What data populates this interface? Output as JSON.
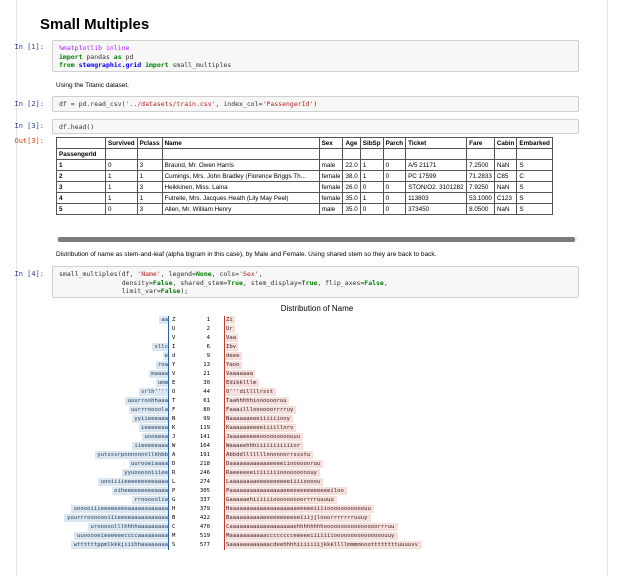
{
  "heading": "Small Multiples",
  "cells": {
    "c1": {
      "prompt": "In [1]:",
      "l1": "%matplotlib inline",
      "l2a": "import",
      "l2b": " pandas ",
      "l2c": "as",
      "l2d": " pd",
      "l3a": "from",
      "l3b": " stemgraphic.grid ",
      "l3c": "import",
      "l3d": " small_multiples"
    },
    "md1": "Using the Titanic dataset.",
    "c2": {
      "prompt": "In [2]:",
      "code_a": "df = pd.read_csv(",
      "code_b": "'../datasets/train.csv'",
      "code_c": ", index_col=",
      "code_d": "'PassengerId'",
      "code_e": ")"
    },
    "c3": {
      "prompt": "In [3]:",
      "code": "df.head()",
      "out_prompt": "Out[3]:"
    },
    "md2": "Distribution of name as stem-and-leaf (alpha bigram in this case), by Male and Female. Using shared stem so they are back to back.",
    "c4": {
      "prompt": "In [4]:",
      "l1a": "small_multiples(df, ",
      "l1b": "'Name'",
      "l1c": ", legend=",
      "l1d": "None",
      "l1e": ", cols=",
      "l1f": "'Sex'",
      "l1g": ",",
      "l2a": "                density=",
      "l2b": "False",
      "l2c": ", shared_stem=",
      "l2d": "True",
      "l2e": ", stem_display=",
      "l2f": "True",
      "l2g": ", flip_axes=",
      "l2h": "False",
      "l2i": ",",
      "l3a": "                limit_var=",
      "l3b": "False",
      "l3c": ");"
    }
  },
  "table": {
    "columns": [
      "",
      "Survived",
      "Pclass",
      "Name",
      "Sex",
      "Age",
      "SibSp",
      "Parch",
      "Ticket",
      "Fare",
      "Cabin",
      "Embarked"
    ],
    "index_name": "PassengerId",
    "rows": [
      [
        "1",
        "0",
        "3",
        "Braund, Mr. Owen Harris",
        "male",
        "22.0",
        "1",
        "0",
        "A/5 21171",
        "7.2500",
        "NaN",
        "S"
      ],
      [
        "2",
        "1",
        "1",
        "Cumings, Mrs. John Bradley (Florence Briggs Th...",
        "female",
        "38.0",
        "1",
        "0",
        "PC 17599",
        "71.2833",
        "C85",
        "C"
      ],
      [
        "3",
        "1",
        "3",
        "Heikkinen, Miss. Laina",
        "female",
        "26.0",
        "0",
        "0",
        "STON/O2. 3101282",
        "7.9250",
        "NaN",
        "S"
      ],
      [
        "4",
        "1",
        "1",
        "Futrelle, Mrs. Jacques Heath (Lily May Peel)",
        "female",
        "35.0",
        "1",
        "0",
        "113803",
        "53.1000",
        "C123",
        "S"
      ],
      [
        "5",
        "0",
        "3",
        "Allen, Mr. William Henry",
        "male",
        "35.0",
        "0",
        "0",
        "373450",
        "8.0500",
        "NaN",
        "S"
      ]
    ]
  },
  "chart_data": {
    "type": "table",
    "title": "Distribution of Name",
    "rows": [
      {
        "left": "aa",
        "stem": "Z",
        "cum": "1",
        "right": "Zi"
      },
      {
        "left": "",
        "stem": "U",
        "cum": "2",
        "right": "Ur"
      },
      {
        "left": "",
        "stem": "V",
        "cum": "4",
        "right": "Vaa"
      },
      {
        "left": "sllc",
        "stem": "I",
        "cum": "6",
        "right": "Ibv"
      },
      {
        "left": "e",
        "stem": "d",
        "cum": "9",
        "right": "deee"
      },
      {
        "left": "roa",
        "stem": "Y",
        "cum": "13",
        "right": "Yaoo"
      },
      {
        "left": "maaaa",
        "stem": "V",
        "cum": "21",
        "right": "Vaaaaaaa"
      },
      {
        "left": "umm",
        "stem": "E",
        "cum": "30",
        "right": "Edikklllm"
      },
      {
        "left": "srlh''''",
        "stem": "O",
        "cum": "44",
        "right": "O'''dillllrsst"
      },
      {
        "left": "uuurroohhaaa",
        "stem": "T",
        "cum": "61",
        "right": "Taahhhhhiooooooruu"
      },
      {
        "left": "uurrroooola",
        "stem": "F",
        "cum": "80",
        "right": "Faaaillloooooorrrruy"
      },
      {
        "left": "yyiieeeaaa",
        "stem": "N",
        "cum": "99",
        "right": "Naaaaaaeeeiiiiiiooy"
      },
      {
        "left": "ieeeeeaa",
        "stem": "K",
        "cum": "119",
        "right": "Kaaaaaaeeeeiiiillnrv"
      },
      {
        "left": "uooeeea",
        "stem": "J",
        "cum": "141",
        "right": "Jaaaaeeeeeooooooooouuu"
      },
      {
        "left": "iieeeeeaaa",
        "stem": "W",
        "cum": "164",
        "right": "Waaaeehhhiiiiiiiiiiior"
      },
      {
        "left": "yutsssrpnnnnnnnllkhbb",
        "stem": "A",
        "cum": "191",
        "right": "Abbddlllllllnnnnnnrrssstu"
      },
      {
        "left": "uurooeiaaaa",
        "stem": "D",
        "cum": "218",
        "right": "Daaaaaaaaaaaaeeeeiiooooooruu"
      },
      {
        "left": "yyuoooooiiiee",
        "stem": "R",
        "cum": "246",
        "right": "Raeeeeeeiiiiiiiiooooooooouy"
      },
      {
        "left": "uooiiiieeeeeeeeeaaaa",
        "stem": "L",
        "cum": "274",
        "right": "Laaaaaaaaeeeeeeeeeeiiiioooou"
      },
      {
        "left": "oiheeeeeeeeeaaaa",
        "stem": "P",
        "cum": "305",
        "right": "Paaaaaaaaaaaaaaaaeeeeeeeeeeeeeeiloo"
      },
      {
        "left": "rrooooolia",
        "stem": "G",
        "cum": "337",
        "right": "Gaaaaaehiiiiiiooooooooorrrruuuuu"
      },
      {
        "left": "oooooiiieeeeeeeeaaaaaaaaaaaa",
        "stem": "H",
        "cum": "379",
        "right": "Haaaaaaaaaaaaaaaaaaaaeeeeeiiiiooooooooooouu"
      },
      {
        "left": "yuurrrooooooiiieeeeaaaaaaaaaaa",
        "stem": "B",
        "cum": "422",
        "right": "Baaaaaaaaaaeeeeeeeeeeeiiijjlooorrrrrrruuuy"
      },
      {
        "left": "urooooolllhhhhaaaaaaaaa",
        "stem": "C",
        "cum": "470",
        "right": "Caaaaaaaaaaaaaaaaaaaehhhhhhhhoooooooooooooooorrruu"
      },
      {
        "left": "uuooooeieeeeeeccccaaaaaaaaa",
        "stem": "M",
        "cum": "519",
        "right": "Maaaaaaaaaaacccccccceeeeeiiiiiiiooooooooooooooouuy"
      },
      {
        "left": "wttttttppmlkkkjiiihhaaaaaaaa",
        "stem": "S",
        "cum": "577",
        "right": "Saaaaaaaaaaaacdeehhhhiiiiiiijkkkllllmmmmooottttttttuuuuvv"
      }
    ]
  },
  "colors": {
    "left_bg": "#dbe6f0",
    "right_bg": "#f6e0dc",
    "left_line": "#2563a6",
    "right_line": "#c0392b"
  }
}
